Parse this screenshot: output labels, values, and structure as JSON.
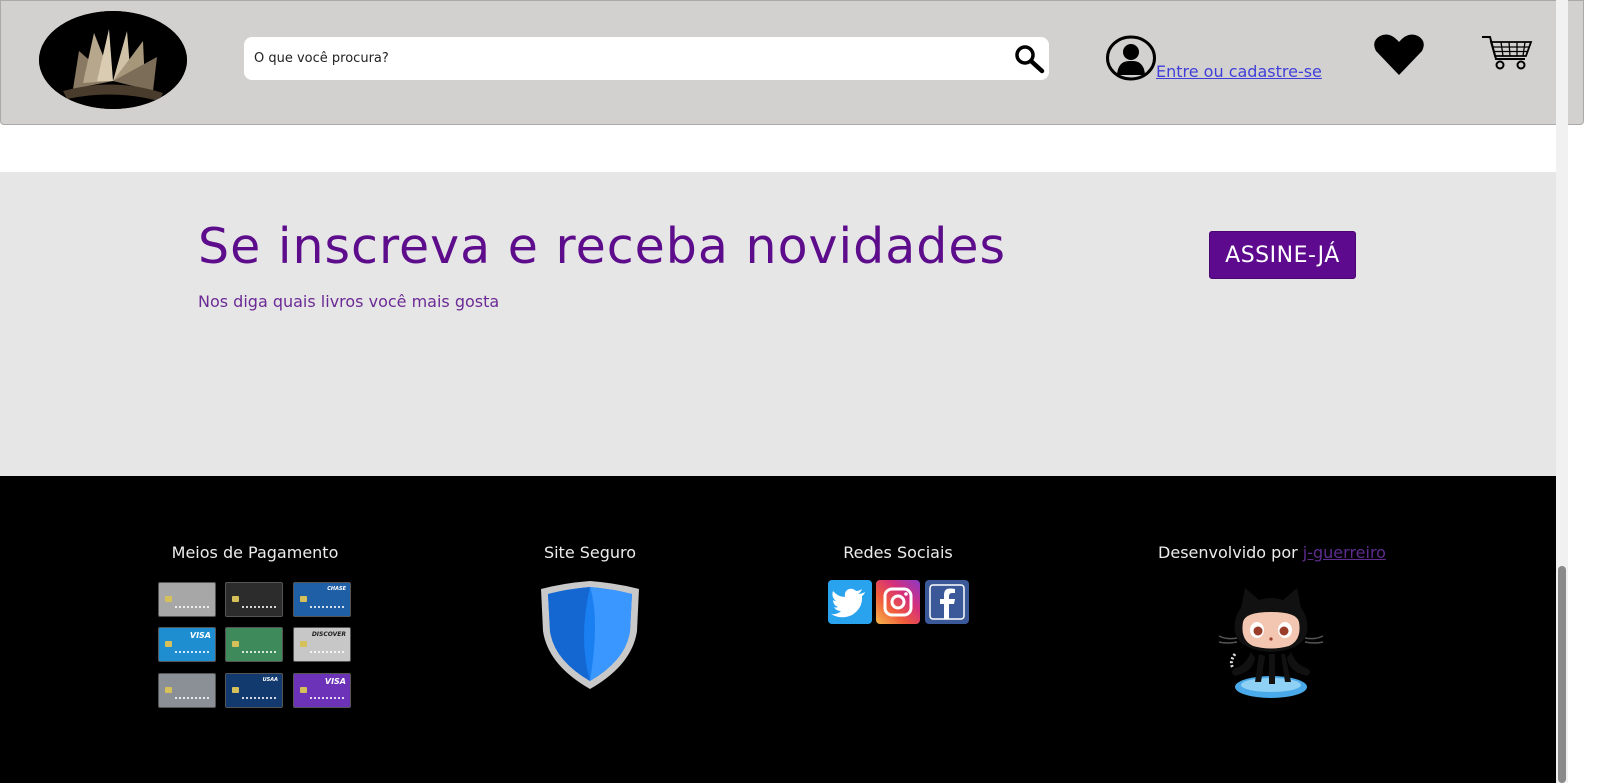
{
  "header": {
    "search": {
      "placeholder": "O que você procura?"
    },
    "login_link": "Entre ou cadastre-se"
  },
  "newsletter": {
    "title": "Se inscreva e receba novidades",
    "subtitle": "Nos diga quais livros você mais gosta",
    "button": "ASSINE-JÁ"
  },
  "footer": {
    "payment": {
      "title": "Meios de Pagamento",
      "cards": [
        {
          "brand": "",
          "color": "#a7a7a7"
        },
        {
          "brand": "",
          "color": "#2c2c2c"
        },
        {
          "brand": "CHASE",
          "color": "#1f5fa6"
        },
        {
          "brand": "VISA",
          "color": "#1e8ed1"
        },
        {
          "brand": "",
          "color": "#3e8a5b"
        },
        {
          "brand": "DISCOVER",
          "color": "#c7c7c7"
        },
        {
          "brand": "",
          "color": "#8b9096"
        },
        {
          "brand": "USAA",
          "color": "#123a6e"
        },
        {
          "brand": "VISA",
          "color": "#6c32b8"
        }
      ]
    },
    "secure": {
      "title": "Site Seguro"
    },
    "social": {
      "title": "Redes Sociais"
    },
    "developer": {
      "prefix": "Desenvolvido por ",
      "link": "j-guerreiro"
    }
  },
  "colors": {
    "accent": "#5d0a8e",
    "header_bg": "#d3d1d0",
    "newsletter_bg": "#e7e6e7",
    "footer_bg": "#000000",
    "link": "#3f3fd8"
  }
}
